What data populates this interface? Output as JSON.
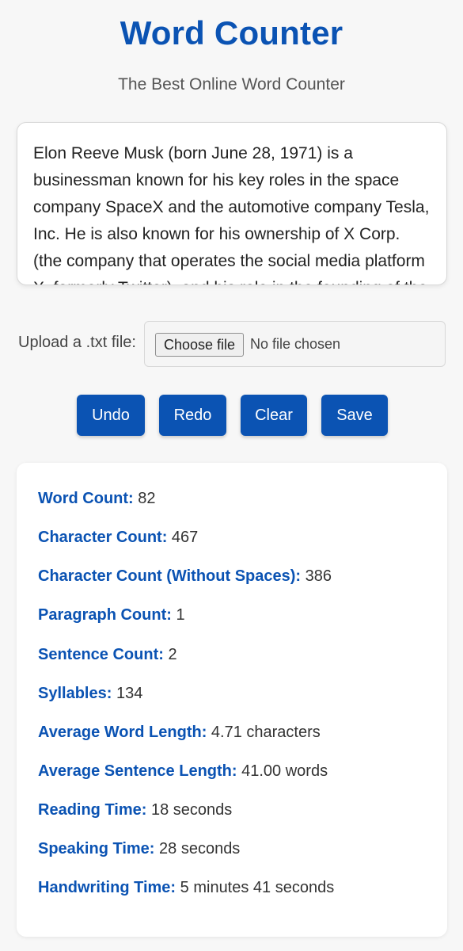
{
  "header": {
    "title": "Word Counter",
    "subtitle": "The Best Online Word Counter"
  },
  "editor": {
    "text": "Elon Reeve Musk (born June 28, 1971) is a businessman known for his key roles in the space company SpaceX and the automotive company Tesla, Inc. He is also known for his ownership of X Corp. (the company that operates the social media platform X, formerly Twitter), and his role in the founding of the"
  },
  "upload": {
    "label": "Upload a .txt file:",
    "button": "Choose file",
    "status": "No file chosen"
  },
  "toolbar": {
    "undo": "Undo",
    "redo": "Redo",
    "clear": "Clear",
    "save": "Save"
  },
  "colors": {
    "accent": "#0b53b3",
    "background": "#f7f7f7"
  },
  "stats": [
    {
      "label": "Word Count:",
      "value": "82"
    },
    {
      "label": "Character Count:",
      "value": "467"
    },
    {
      "label": "Character Count (Without Spaces):",
      "value": "386"
    },
    {
      "label": "Paragraph Count:",
      "value": "1"
    },
    {
      "label": "Sentence Count:",
      "value": "2"
    },
    {
      "label": "Syllables:",
      "value": "134"
    },
    {
      "label": "Average Word Length:",
      "value": "4.71 characters"
    },
    {
      "label": "Average Sentence Length:",
      "value": "41.00 words"
    },
    {
      "label": "Reading Time:",
      "value": "18 seconds"
    },
    {
      "label": "Speaking Time:",
      "value": "28 seconds"
    },
    {
      "label": "Handwriting Time:",
      "value": "5 minutes 41 seconds"
    }
  ]
}
